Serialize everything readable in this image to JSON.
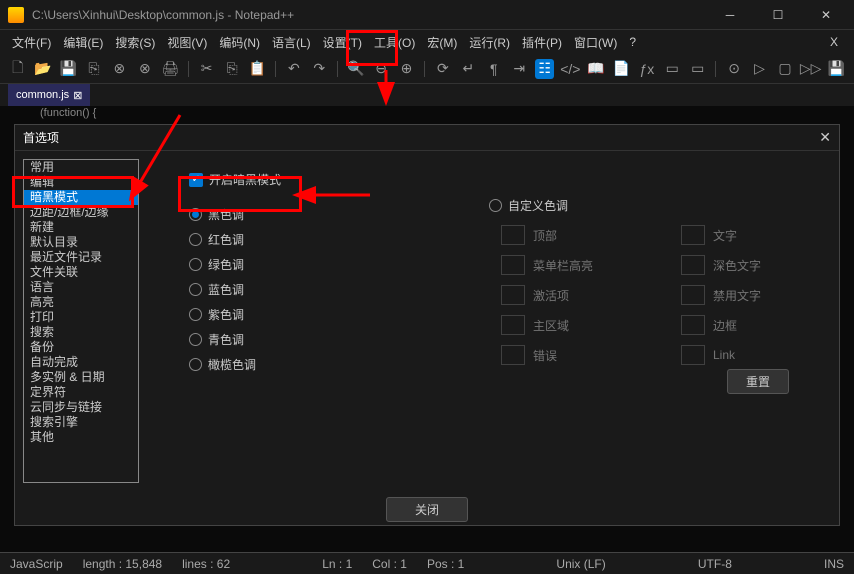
{
  "window": {
    "title": "C:\\Users\\Xinhui\\Desktop\\common.js - Notepad++"
  },
  "menu": {
    "items": [
      "文件(F)",
      "编辑(E)",
      "搜索(S)",
      "视图(V)",
      "编码(N)",
      "语言(L)",
      "设置(T)",
      "工具(O)",
      "宏(M)",
      "运行(R)",
      "插件(P)",
      "窗口(W)",
      "?"
    ]
  },
  "tab": {
    "name": "common.js",
    "close": "⊠"
  },
  "editor": {
    "line": "(function() {"
  },
  "dialog": {
    "title": "首选项",
    "close_label": "关闭"
  },
  "sidebar": {
    "items": [
      "常用",
      "编辑",
      "暗黑模式",
      "边距/边框/边缘",
      "新建",
      "默认目录",
      "最近文件记录",
      "文件关联",
      "语言",
      "高亮",
      "打印",
      "搜索",
      "备份",
      "自动完成",
      "多实例 & 日期",
      "定界符",
      "云同步与链接",
      "搜索引擎",
      "其他"
    ],
    "selected_index": 2
  },
  "content": {
    "enable_dark": "开启暗黑模式",
    "tones": [
      "黑色调",
      "红色调",
      "绿色调",
      "蓝色调",
      "紫色调",
      "青色调",
      "橄榄色调"
    ],
    "custom_tone": "自定义色调",
    "selected_tone": 0,
    "color_items": [
      "顶部",
      "文字",
      "菜单栏高亮",
      "深色文字",
      "激活项",
      "禁用文字",
      "主区域",
      "边框",
      "错误",
      "Link"
    ],
    "reset": "重置"
  },
  "status": {
    "lang": "JavaScrip",
    "length": "length : 15,848",
    "lines": "lines : 62",
    "ln": "Ln : 1",
    "col": "Col : 1",
    "pos": "Pos : 1",
    "eol": "Unix (LF)",
    "encoding": "UTF-8",
    "mode": "INS"
  }
}
